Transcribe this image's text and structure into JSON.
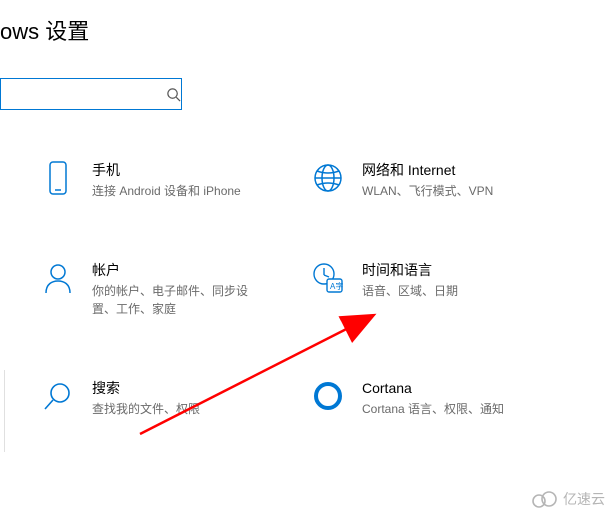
{
  "header": {
    "title_fragment": "ows 设置"
  },
  "search": {
    "placeholder": ""
  },
  "tiles": {
    "phone": {
      "title": "手机",
      "sub": "连接 Android 设备和 iPhone"
    },
    "network": {
      "title": "网络和 Internet",
      "sub": "WLAN、飞行模式、VPN"
    },
    "accounts": {
      "title": "帐户",
      "sub": "你的帐户、电子邮件、同步设置、工作、家庭"
    },
    "timelang": {
      "title": "时间和语言",
      "sub": "语音、区域、日期"
    },
    "search": {
      "title": "搜索",
      "sub": "查找我的文件、权限"
    },
    "cortana": {
      "title": "Cortana",
      "sub": "Cortana 语言、权限、通知"
    }
  },
  "annotation": {
    "arrow_color": "#ff0000"
  },
  "watermark": {
    "text": "亿速云"
  }
}
